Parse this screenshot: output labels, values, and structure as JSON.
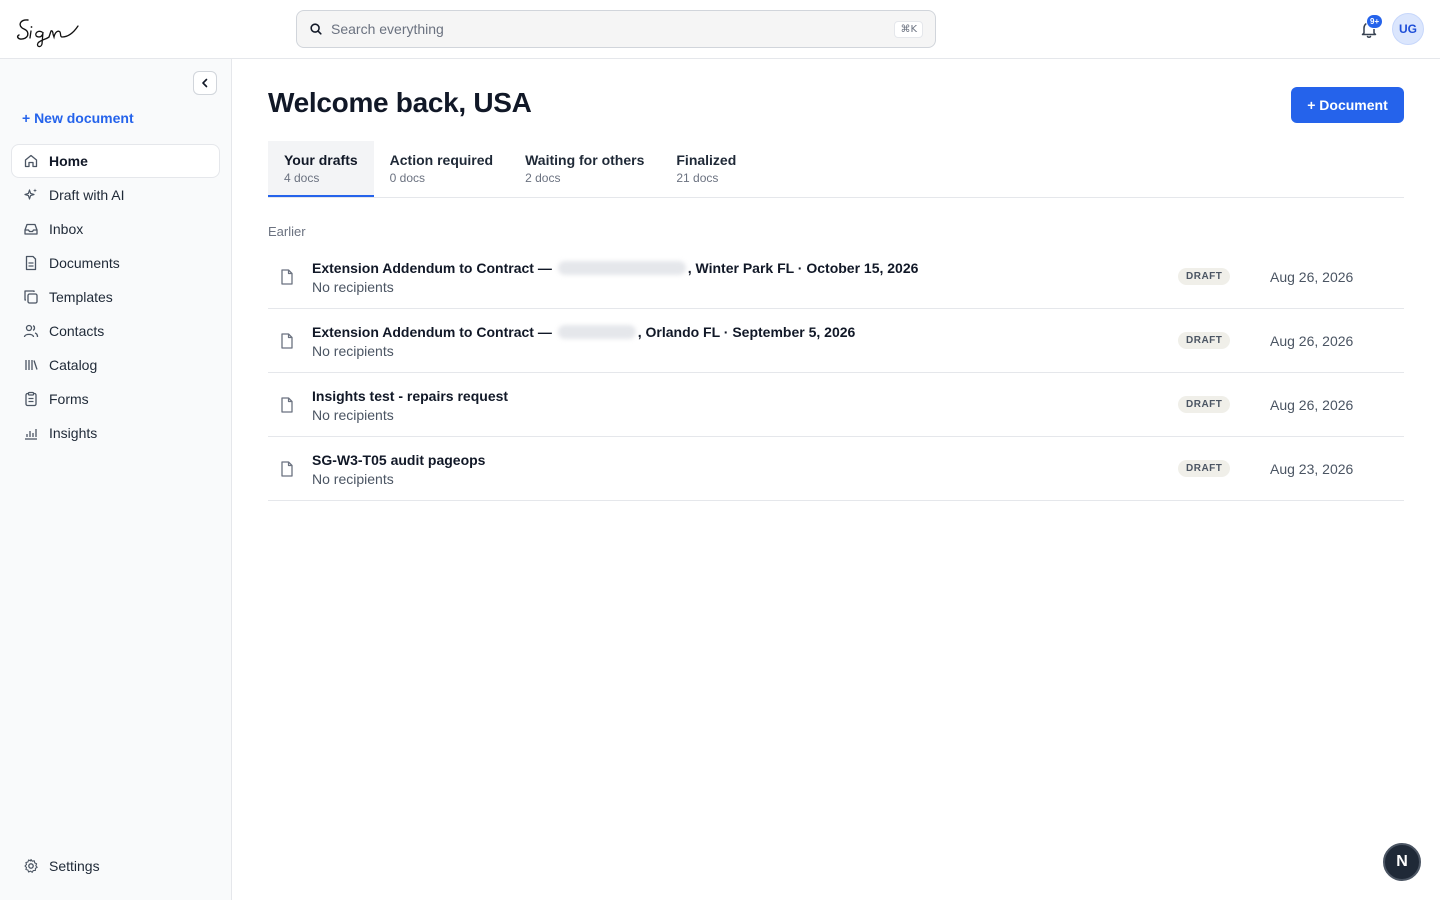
{
  "header": {
    "search_placeholder": "Search everything",
    "search_shortcut": "⌘K",
    "notification_count": "9+",
    "avatar_initials": "UG"
  },
  "sidebar": {
    "new_document": "+ New document",
    "items": [
      {
        "label": "Home",
        "icon": "home-icon",
        "active": true
      },
      {
        "label": "Draft with AI",
        "icon": "sparkle-icon"
      },
      {
        "label": "Inbox",
        "icon": "inbox-icon"
      },
      {
        "label": "Documents",
        "icon": "document-icon"
      },
      {
        "label": "Templates",
        "icon": "templates-icon"
      },
      {
        "label": "Contacts",
        "icon": "contacts-icon"
      },
      {
        "label": "Catalog",
        "icon": "catalog-icon"
      },
      {
        "label": "Forms",
        "icon": "forms-icon"
      },
      {
        "label": "Insights",
        "icon": "insights-icon"
      }
    ],
    "settings": "Settings"
  },
  "main": {
    "title": "Welcome back, USA",
    "add_document": "+ Document",
    "tabs": [
      {
        "label": "Your drafts",
        "count": "4 docs",
        "active": true
      },
      {
        "label": "Action required",
        "count": "0 docs"
      },
      {
        "label": "Waiting for others",
        "count": "2 docs"
      },
      {
        "label": "Finalized",
        "count": "21 docs"
      }
    ],
    "section_label": "Earlier",
    "documents": [
      {
        "title_before": "Extension Addendum to Contract —",
        "title_after": ", Winter Park FL · October 15, 2026",
        "subtitle": "No recipients",
        "status": "DRAFT",
        "date": "Aug 26, 2026"
      },
      {
        "title_before": "Extension Addendum to Contract —",
        "title_after": ", Orlando FL · September 5, 2026",
        "subtitle": "No recipients",
        "status": "DRAFT",
        "date": "Aug 26, 2026"
      },
      {
        "title_before": "Insights test - repairs request",
        "title_after": "",
        "subtitle": "No recipients",
        "status": "DRAFT",
        "date": "Aug 26, 2026"
      },
      {
        "title_before": "SG-W3-T05 audit pageops",
        "title_after": "",
        "subtitle": "No recipients",
        "status": "DRAFT",
        "date": "Aug 23, 2026"
      }
    ]
  },
  "fab_label": "N",
  "colors": {
    "accent": "#2563eb",
    "sidebar_bg": "#f9fafb",
    "badge_bg": "#f0efe9"
  }
}
